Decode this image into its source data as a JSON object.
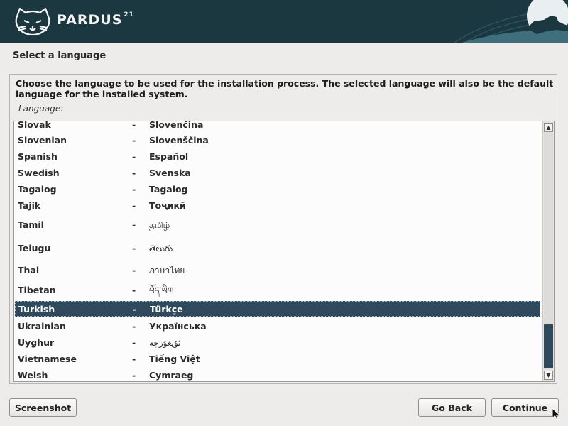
{
  "banner": {
    "brand": "PARDUS",
    "version": "21"
  },
  "page": {
    "title": "Select a language",
    "description": "Choose the language to be used for the installation process. The selected language will also be the default language for the installed system.",
    "list_label": "Language:"
  },
  "languages": [
    {
      "name": "Slovak",
      "native": "Slovenčina"
    },
    {
      "name": "Slovenian",
      "native": "Slovenščina"
    },
    {
      "name": "Spanish",
      "native": "Español"
    },
    {
      "name": "Swedish",
      "native": "Svenska"
    },
    {
      "name": "Tagalog",
      "native": "Tagalog"
    },
    {
      "name": "Tajik",
      "native": "Тоҷикӣ"
    },
    {
      "name": "Tamil",
      "native": "தமிழ்"
    },
    {
      "name": "Telugu",
      "native": "తెలుగు"
    },
    {
      "name": "Thai",
      "native": "ภาษาไทย"
    },
    {
      "name": "Tibetan",
      "native": "བོད་ཡིག"
    },
    {
      "name": "Turkish",
      "native": "Türkçe"
    },
    {
      "name": "Ukrainian",
      "native": "Українська"
    },
    {
      "name": "Uyghur",
      "native": "ئۇيغۇرچە"
    },
    {
      "name": "Vietnamese",
      "native": "Tiếng Việt"
    },
    {
      "name": "Welsh",
      "native": "Cymraeg"
    }
  ],
  "separator": "-",
  "selected_language": "Turkish",
  "buttons": {
    "screenshot": "Screenshot",
    "back": "Go Back",
    "continue": "Continue"
  },
  "colors": {
    "banner": "#1b3740",
    "selection": "#2f4a5c"
  }
}
